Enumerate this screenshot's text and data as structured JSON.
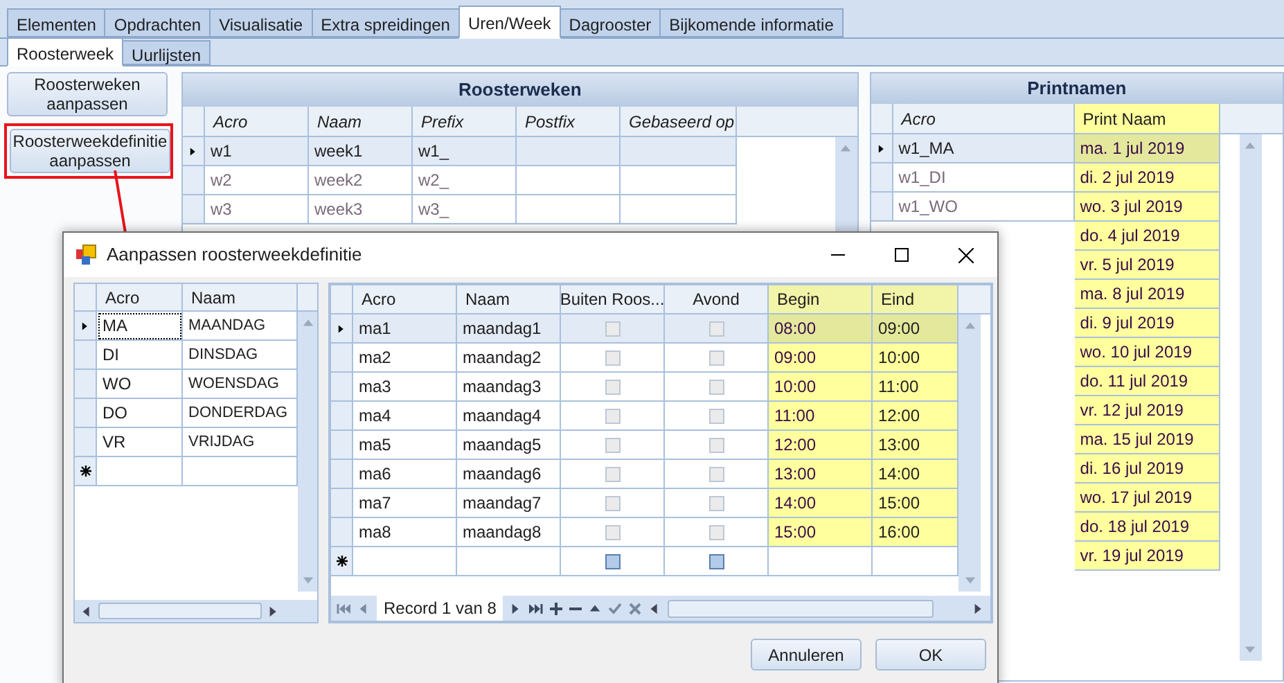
{
  "tabs": [
    {
      "label": "Elementen",
      "selected": false
    },
    {
      "label": "Opdrachten",
      "selected": false
    },
    {
      "label": "Visualisatie",
      "selected": false
    },
    {
      "label": "Extra spreidingen",
      "selected": false
    },
    {
      "label": "Uren/Week",
      "selected": true
    },
    {
      "label": "Dagrooster",
      "selected": false
    },
    {
      "label": "Bijkomende informatie",
      "selected": false
    }
  ],
  "subtabs": [
    {
      "label": "Roosterweek",
      "selected": true
    },
    {
      "label": "Uurlijsten",
      "selected": false
    }
  ],
  "side_buttons": [
    {
      "label": "Roosterweken aanpassen",
      "highlighted": false
    },
    {
      "label": "Roosterweekdefinitie aanpassen",
      "highlighted": true
    }
  ],
  "roosterweken": {
    "title": "Roosterweken",
    "columns": [
      "Acro",
      "Naam",
      "Prefix",
      "Postfix",
      "Gebaseerd op"
    ],
    "rows": [
      {
        "cells": [
          "w1",
          "week1",
          "w1_",
          "",
          ""
        ],
        "selected": true
      },
      {
        "cells": [
          "w2",
          "week2",
          "w2_",
          "",
          ""
        ],
        "selected": false
      },
      {
        "cells": [
          "w3",
          "week3",
          "w3_",
          "",
          ""
        ],
        "selected": false
      }
    ]
  },
  "printnamen": {
    "title": "Printnamen",
    "columns": [
      "Acro",
      "Print Naam"
    ],
    "rows": [
      {
        "acro": "w1_MA",
        "print_naam": "ma. 1 jul 2019",
        "selected": true
      },
      {
        "acro": "w1_DI",
        "print_naam": "di. 2 jul 2019",
        "selected": false
      },
      {
        "acro": "w1_WO",
        "print_naam": "wo. 3 jul 2019",
        "selected": false
      },
      {
        "print_naam": "do. 4 jul 2019",
        "selected": false
      },
      {
        "print_naam": "vr. 5 jul 2019",
        "selected": false
      },
      {
        "print_naam": "ma. 8 jul 2019",
        "selected": false
      },
      {
        "print_naam": "di. 9 jul 2019",
        "selected": false
      },
      {
        "print_naam": "wo. 10 jul 2019",
        "selected": false
      },
      {
        "print_naam": "do. 11 jul 2019",
        "selected": false
      },
      {
        "print_naam": "vr. 12 jul 2019",
        "selected": false
      },
      {
        "print_naam": "ma. 15 jul 2019",
        "selected": false
      },
      {
        "print_naam": "di. 16 jul 2019",
        "selected": false
      },
      {
        "print_naam": "wo. 17 jul 2019",
        "selected": false
      },
      {
        "print_naam": "do. 18 jul 2019",
        "selected": false
      },
      {
        "print_naam": "vr. 19 jul 2019",
        "selected": false
      }
    ]
  },
  "dialog": {
    "title": "Aanpassen roosterweekdefinitie",
    "days": {
      "columns": [
        "Acro",
        "Naam"
      ],
      "rows": [
        {
          "acro": "MA",
          "naam": "MAANDAG",
          "selected": true
        },
        {
          "acro": "DI",
          "naam": "DINSDAG",
          "selected": false
        },
        {
          "acro": "WO",
          "naam": "WOENSDAG",
          "selected": false
        },
        {
          "acro": "DO",
          "naam": "DONDERDAG",
          "selected": false
        },
        {
          "acro": "VR",
          "naam": "VRIJDAG",
          "selected": false
        }
      ]
    },
    "hours": {
      "columns": [
        "Acro",
        "Naam",
        "Buiten Roos...",
        "Avond",
        "Begin",
        "Eind"
      ],
      "rows": [
        {
          "acro": "ma1",
          "naam": "maandag1",
          "buiten": false,
          "avond": false,
          "begin": "08:00",
          "eind": "09:00",
          "selected": true
        },
        {
          "acro": "ma2",
          "naam": "maandag2",
          "buiten": false,
          "avond": false,
          "begin": "09:00",
          "eind": "10:00",
          "selected": false
        },
        {
          "acro": "ma3",
          "naam": "maandag3",
          "buiten": false,
          "avond": false,
          "begin": "10:00",
          "eind": "11:00",
          "selected": false
        },
        {
          "acro": "ma4",
          "naam": "maandag4",
          "buiten": false,
          "avond": false,
          "begin": "11:00",
          "eind": "12:00",
          "selected": false
        },
        {
          "acro": "ma5",
          "naam": "maandag5",
          "buiten": false,
          "avond": false,
          "begin": "12:00",
          "eind": "13:00",
          "selected": false
        },
        {
          "acro": "ma6",
          "naam": "maandag6",
          "buiten": false,
          "avond": false,
          "begin": "13:00",
          "eind": "14:00",
          "selected": false
        },
        {
          "acro": "ma7",
          "naam": "maandag7",
          "buiten": false,
          "avond": false,
          "begin": "14:00",
          "eind": "15:00",
          "selected": false
        },
        {
          "acro": "ma8",
          "naam": "maandag8",
          "buiten": false,
          "avond": false,
          "begin": "15:00",
          "eind": "16:00",
          "selected": false
        }
      ],
      "new_row": {
        "buiten_indeterminate": true,
        "avond_indeterminate": true
      },
      "navigator": "Record 1 van 8"
    },
    "buttons": [
      "Annuleren",
      "OK"
    ]
  }
}
